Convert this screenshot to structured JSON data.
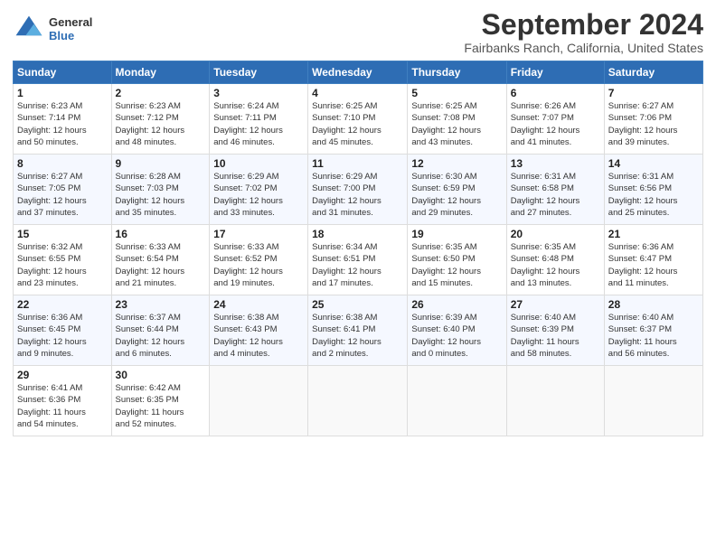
{
  "logo": {
    "line1": "General",
    "line2": "Blue"
  },
  "title": "September 2024",
  "location": "Fairbanks Ranch, California, United States",
  "days_header": [
    "Sunday",
    "Monday",
    "Tuesday",
    "Wednesday",
    "Thursday",
    "Friday",
    "Saturday"
  ],
  "weeks": [
    [
      {
        "day": "1",
        "info": "Sunrise: 6:23 AM\nSunset: 7:14 PM\nDaylight: 12 hours\nand 50 minutes."
      },
      {
        "day": "2",
        "info": "Sunrise: 6:23 AM\nSunset: 7:12 PM\nDaylight: 12 hours\nand 48 minutes."
      },
      {
        "day": "3",
        "info": "Sunrise: 6:24 AM\nSunset: 7:11 PM\nDaylight: 12 hours\nand 46 minutes."
      },
      {
        "day": "4",
        "info": "Sunrise: 6:25 AM\nSunset: 7:10 PM\nDaylight: 12 hours\nand 45 minutes."
      },
      {
        "day": "5",
        "info": "Sunrise: 6:25 AM\nSunset: 7:08 PM\nDaylight: 12 hours\nand 43 minutes."
      },
      {
        "day": "6",
        "info": "Sunrise: 6:26 AM\nSunset: 7:07 PM\nDaylight: 12 hours\nand 41 minutes."
      },
      {
        "day": "7",
        "info": "Sunrise: 6:27 AM\nSunset: 7:06 PM\nDaylight: 12 hours\nand 39 minutes."
      }
    ],
    [
      {
        "day": "8",
        "info": "Sunrise: 6:27 AM\nSunset: 7:05 PM\nDaylight: 12 hours\nand 37 minutes."
      },
      {
        "day": "9",
        "info": "Sunrise: 6:28 AM\nSunset: 7:03 PM\nDaylight: 12 hours\nand 35 minutes."
      },
      {
        "day": "10",
        "info": "Sunrise: 6:29 AM\nSunset: 7:02 PM\nDaylight: 12 hours\nand 33 minutes."
      },
      {
        "day": "11",
        "info": "Sunrise: 6:29 AM\nSunset: 7:00 PM\nDaylight: 12 hours\nand 31 minutes."
      },
      {
        "day": "12",
        "info": "Sunrise: 6:30 AM\nSunset: 6:59 PM\nDaylight: 12 hours\nand 29 minutes."
      },
      {
        "day": "13",
        "info": "Sunrise: 6:31 AM\nSunset: 6:58 PM\nDaylight: 12 hours\nand 27 minutes."
      },
      {
        "day": "14",
        "info": "Sunrise: 6:31 AM\nSunset: 6:56 PM\nDaylight: 12 hours\nand 25 minutes."
      }
    ],
    [
      {
        "day": "15",
        "info": "Sunrise: 6:32 AM\nSunset: 6:55 PM\nDaylight: 12 hours\nand 23 minutes."
      },
      {
        "day": "16",
        "info": "Sunrise: 6:33 AM\nSunset: 6:54 PM\nDaylight: 12 hours\nand 21 minutes."
      },
      {
        "day": "17",
        "info": "Sunrise: 6:33 AM\nSunset: 6:52 PM\nDaylight: 12 hours\nand 19 minutes."
      },
      {
        "day": "18",
        "info": "Sunrise: 6:34 AM\nSunset: 6:51 PM\nDaylight: 12 hours\nand 17 minutes."
      },
      {
        "day": "19",
        "info": "Sunrise: 6:35 AM\nSunset: 6:50 PM\nDaylight: 12 hours\nand 15 minutes."
      },
      {
        "day": "20",
        "info": "Sunrise: 6:35 AM\nSunset: 6:48 PM\nDaylight: 12 hours\nand 13 minutes."
      },
      {
        "day": "21",
        "info": "Sunrise: 6:36 AM\nSunset: 6:47 PM\nDaylight: 12 hours\nand 11 minutes."
      }
    ],
    [
      {
        "day": "22",
        "info": "Sunrise: 6:36 AM\nSunset: 6:45 PM\nDaylight: 12 hours\nand 9 minutes."
      },
      {
        "day": "23",
        "info": "Sunrise: 6:37 AM\nSunset: 6:44 PM\nDaylight: 12 hours\nand 6 minutes."
      },
      {
        "day": "24",
        "info": "Sunrise: 6:38 AM\nSunset: 6:43 PM\nDaylight: 12 hours\nand 4 minutes."
      },
      {
        "day": "25",
        "info": "Sunrise: 6:38 AM\nSunset: 6:41 PM\nDaylight: 12 hours\nand 2 minutes."
      },
      {
        "day": "26",
        "info": "Sunrise: 6:39 AM\nSunset: 6:40 PM\nDaylight: 12 hours\nand 0 minutes."
      },
      {
        "day": "27",
        "info": "Sunrise: 6:40 AM\nSunset: 6:39 PM\nDaylight: 11 hours\nand 58 minutes."
      },
      {
        "day": "28",
        "info": "Sunrise: 6:40 AM\nSunset: 6:37 PM\nDaylight: 11 hours\nand 56 minutes."
      }
    ],
    [
      {
        "day": "29",
        "info": "Sunrise: 6:41 AM\nSunset: 6:36 PM\nDaylight: 11 hours\nand 54 minutes."
      },
      {
        "day": "30",
        "info": "Sunrise: 6:42 AM\nSunset: 6:35 PM\nDaylight: 11 hours\nand 52 minutes."
      },
      null,
      null,
      null,
      null,
      null
    ]
  ]
}
